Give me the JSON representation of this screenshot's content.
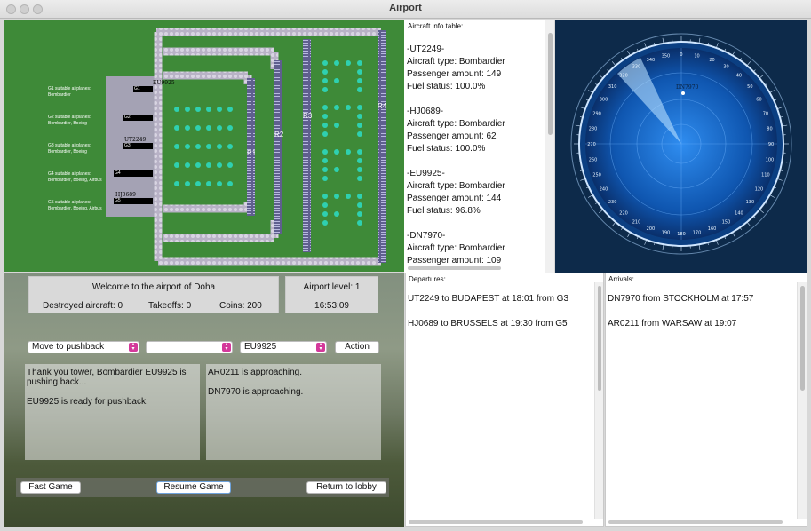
{
  "window": {
    "title": "Airport"
  },
  "map": {
    "gate_infos": [
      {
        "title": "G1 suitable airplanes:",
        "types": "Bombardier"
      },
      {
        "title": "G2 suitable airplanes:",
        "types": "Bombardier, Boeing"
      },
      {
        "title": "G3 suitable airplanes:",
        "types": "Bombardier, Boeing"
      },
      {
        "title": "G4 suitable airplanes:",
        "types": "Bombardier, Boeing, Airbus"
      },
      {
        "title": "G5 suitable airplanes:",
        "types": "Bombardier, Boeing, Airbus"
      }
    ],
    "gates": [
      "G1",
      "G2",
      "G3",
      "G4",
      "G5"
    ],
    "runways": [
      "R1",
      "R2",
      "R3",
      "R4"
    ],
    "plane_tags": [
      "EU9925",
      "UT2249",
      "HJ0689"
    ]
  },
  "info_table": {
    "title": "Aircraft info table:",
    "aircraft": [
      {
        "id": "-UT2249-",
        "type": "Aircraft type: Bombardier",
        "passengers": "Passenger amount: 149",
        "fuel": "Fuel status: 100.0%"
      },
      {
        "id": "-HJ0689-",
        "type": "Aircraft type: Bombardier",
        "passengers": "Passenger amount: 62",
        "fuel": "Fuel status: 100.0%"
      },
      {
        "id": "-EU9925-",
        "type": "Aircraft type: Bombardier",
        "passengers": "Passenger amount: 144",
        "fuel": "Fuel status: 96.8%"
      },
      {
        "id": "-DN7970-",
        "type": "Aircraft type: Bombardier",
        "passengers": "Passenger amount: 109",
        "fuel": ""
      }
    ]
  },
  "radar": {
    "target_label": "DN7970",
    "bearings": [
      "0",
      "10",
      "20",
      "30",
      "40",
      "50",
      "60",
      "70",
      "80",
      "90",
      "100",
      "110",
      "120",
      "130",
      "140",
      "150",
      "160",
      "170",
      "180",
      "190",
      "200",
      "210",
      "220",
      "230",
      "240",
      "250",
      "260",
      "270",
      "280",
      "290",
      "300",
      "310",
      "320",
      "330",
      "340",
      "350"
    ],
    "colors": {
      "background": "#0d2a4a",
      "scope": "#1a6fd0",
      "sweep": "#8fd0ff"
    }
  },
  "status": {
    "welcome": "Welcome to the airport of Doha",
    "destroyed": "Destroyed aircraft: 0",
    "takeoffs": "Takeoffs: 0",
    "coins": "Coins:  200",
    "level": "Airport level:  1",
    "clock": "16:53:09"
  },
  "controls": {
    "command_select": "Move to pushback",
    "target_select": "",
    "aircraft_select": "EU9925",
    "action_label": "Action"
  },
  "messages": {
    "left": [
      "Thank you tower, Bombardier EU9925 is pushing back...",
      "EU9925 is ready for pushback."
    ],
    "right": [
      "AR0211 is approaching.",
      "DN7970 is approaching."
    ]
  },
  "buttons": {
    "fast": "Fast Game",
    "resume": "Resume Game",
    "lobby": "Return to lobby"
  },
  "departures": {
    "title": "Departures:",
    "items": [
      "UT2249 to BUDAPEST at 18:01 from G3",
      "HJ0689 to BRUSSELS at 19:30 from G5"
    ]
  },
  "arrivals": {
    "title": "Arrivals:",
    "items": [
      "DN7970 from STOCKHOLM at 17:57",
      "AR0211 from WARSAW at 19:07"
    ]
  }
}
